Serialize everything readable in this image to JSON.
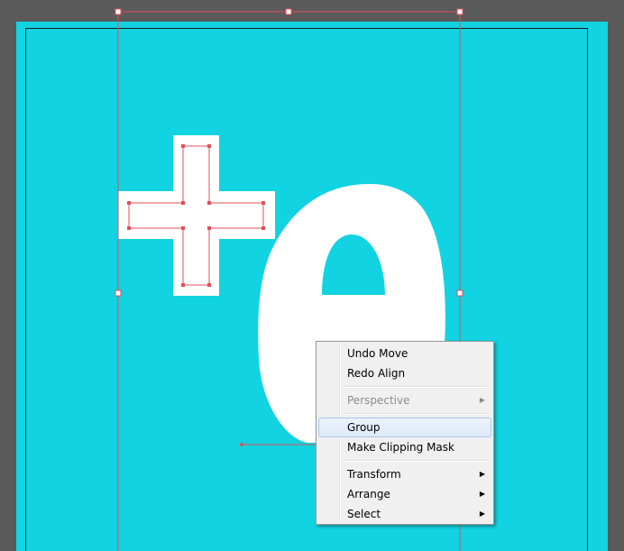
{
  "colors": {
    "pasteboard": "#5a5a5a",
    "artboard": "#12d3e1",
    "artwork": "#ffffff",
    "selection": "#e0505a"
  },
  "context_menu": {
    "items": [
      {
        "label": "Undo Move",
        "enabled": true,
        "submenu": false
      },
      {
        "label": "Redo Align",
        "enabled": true,
        "submenu": false
      },
      {
        "label": "Perspective",
        "enabled": false,
        "submenu": true
      },
      {
        "label": "Group",
        "enabled": true,
        "submenu": false,
        "highlighted": true
      },
      {
        "label": "Make Clipping Mask",
        "enabled": true,
        "submenu": false
      },
      {
        "label": "Transform",
        "enabled": true,
        "submenu": true
      },
      {
        "label": "Arrange",
        "enabled": true,
        "submenu": true
      },
      {
        "label": "Select",
        "enabled": true,
        "submenu": true
      }
    ],
    "submenu_arrow": "▶"
  }
}
